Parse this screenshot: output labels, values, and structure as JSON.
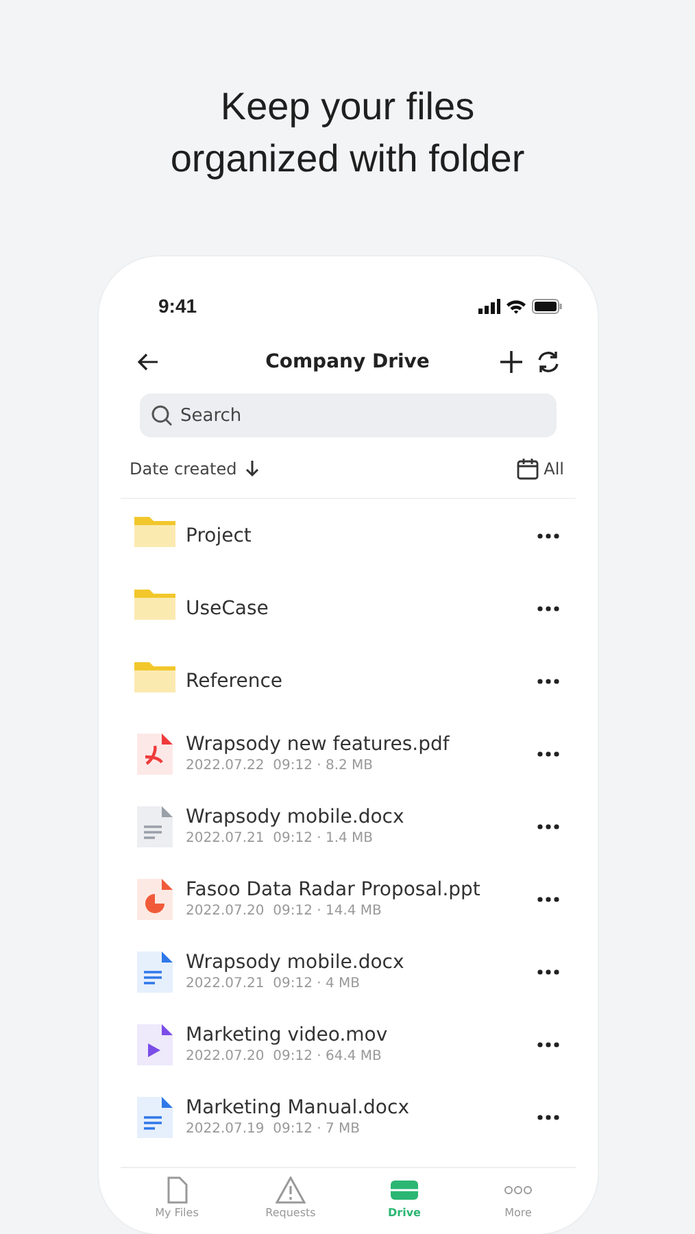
{
  "headline": [
    "Keep your files",
    "organized with folder"
  ],
  "status_bar": {
    "time": "9:41"
  },
  "header": {
    "title": "Company Drive"
  },
  "search": {
    "placeholder": "Search"
  },
  "sort": {
    "label": "Date created",
    "filter": "All"
  },
  "items": [
    {
      "kind": "folder",
      "name": "Project"
    },
    {
      "kind": "folder",
      "name": "UseCase"
    },
    {
      "kind": "folder",
      "name": "Reference"
    },
    {
      "kind": "pdf",
      "name": "Wrapsody new features.pdf",
      "meta": "2022.07.22  09:12 · 8.2 MB"
    },
    {
      "kind": "text",
      "name": "Wrapsody mobile.docx",
      "meta": "2022.07.21  09:12 · 1.4 MB"
    },
    {
      "kind": "ppt",
      "name": "Fasoo Data Radar Proposal.ppt",
      "meta": "2022.07.20  09:12 · 14.4 MB"
    },
    {
      "kind": "doc",
      "name": "Wrapsody mobile.docx",
      "meta": "2022.07.21  09:12 · 4 MB"
    },
    {
      "kind": "video",
      "name": "Marketing video.mov",
      "meta": "2022.07.20  09:12 · 64.4 MB"
    },
    {
      "kind": "doc",
      "name": "Marketing Manual.docx",
      "meta": "2022.07.19  09:12 · 7 MB"
    }
  ],
  "nav": [
    {
      "kind": "files",
      "label": "My Files",
      "selected": false
    },
    {
      "kind": "requests",
      "label": "Requests",
      "selected": false
    },
    {
      "kind": "drive",
      "label": "Drive",
      "selected": true
    },
    {
      "kind": "more",
      "label": "More",
      "selected": false
    }
  ]
}
